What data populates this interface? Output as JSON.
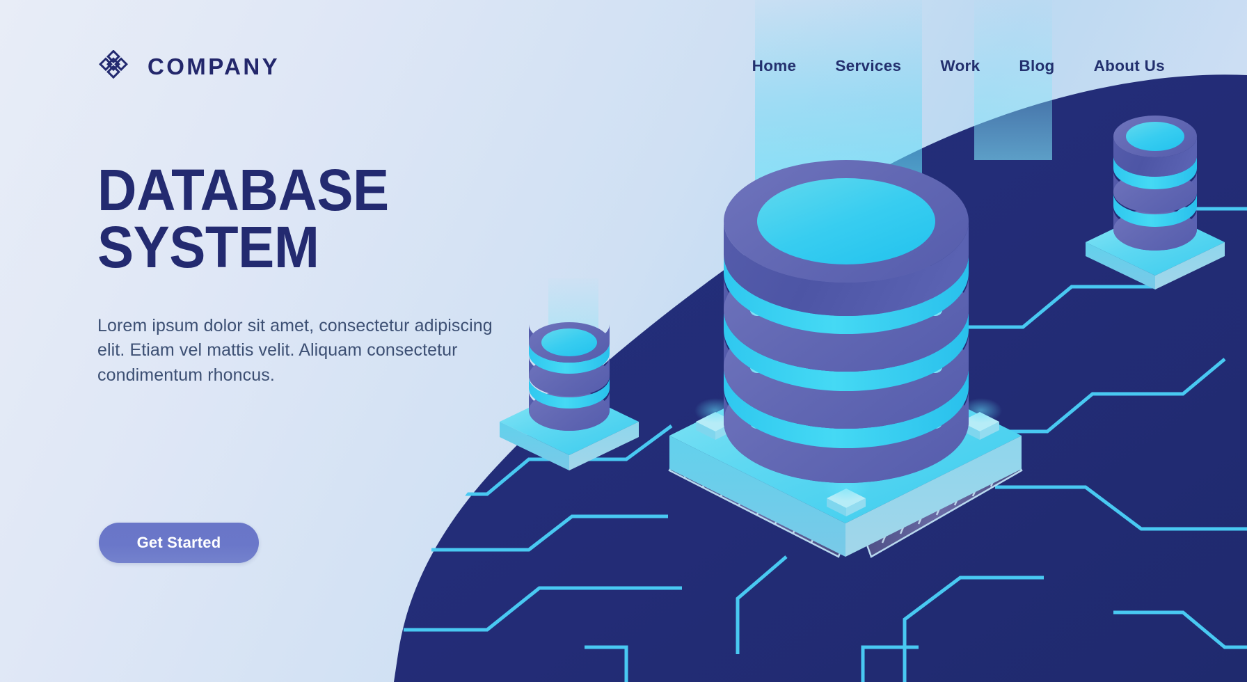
{
  "header": {
    "logo_icon": "diamond-lattice-logo-icon",
    "brand": "COMPANY",
    "nav": [
      {
        "label": "Home"
      },
      {
        "label": "Services"
      },
      {
        "label": "Work"
      },
      {
        "label": "Blog"
      },
      {
        "label": "About Us"
      }
    ]
  },
  "hero": {
    "title_line1": "DATABASE",
    "title_line2": "SYSTEM",
    "paragraph": "Lorem ipsum dolor sit amet, consectetur adipiscing elit. Etiam vel mattis velit. Aliquam consectetur condimentum rhoncus.",
    "cta_label": "Get Started"
  },
  "illustration": {
    "alt": "isometric database servers on circuit board",
    "elements": [
      "main-database-cylinder",
      "left-small-database-cylinder",
      "right-small-database-cylinder",
      "cpu-chip-base",
      "circuit-traces",
      "light-beams"
    ]
  },
  "colors": {
    "brand_navy": "#232a70",
    "nav_navy": "#23306e",
    "body_text": "#3c4f73",
    "cta_bg": "#6a77c9",
    "cta_text": "#ffffff",
    "dark_blob": "#23307c",
    "cyan_accent": "#3fd2f0",
    "cylinder_purple": "#5d63ad",
    "plate_cyan": "#7fe3f2",
    "bg_light": "#e8edf7",
    "bg_blue": "#bcd9f2"
  }
}
